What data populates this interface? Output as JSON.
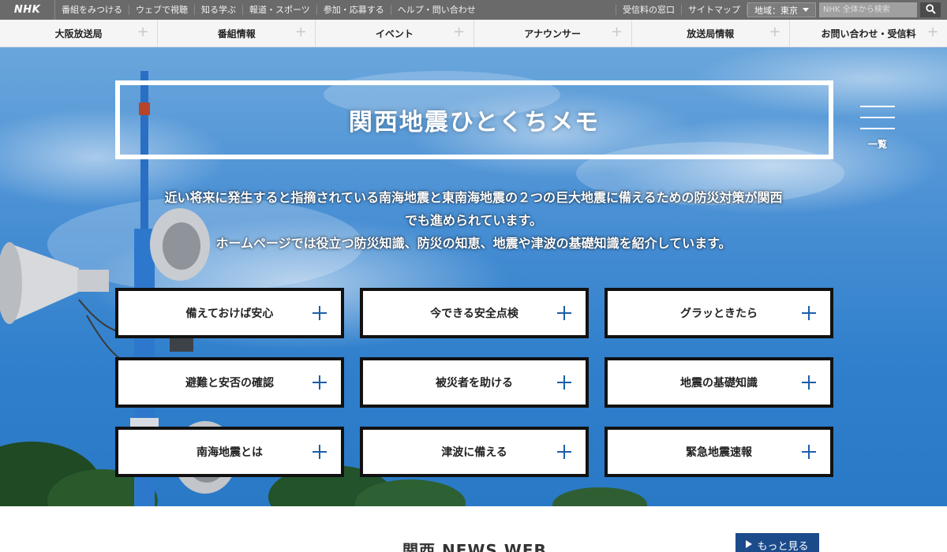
{
  "topbar": {
    "logo": "NHK",
    "links": [
      "番組をみつける",
      "ウェブで視聴",
      "知る学ぶ",
      "報道・スポーツ",
      "参加・応募する",
      "ヘルプ・問い合わせ"
    ],
    "right_links": [
      "受信料の窓口",
      "サイトマップ"
    ],
    "region_label": "地域：東京",
    "search_placeholder": "NHK 全体から検索"
  },
  "nav": {
    "items": [
      "大阪放送局",
      "番組情報",
      "イベント",
      "アナウンサー",
      "放送局情報",
      "お問い合わせ・受信料"
    ]
  },
  "hero": {
    "title": "関西地震ひとくちメモ",
    "menu_label": "一覧",
    "intro_lines": [
      "近い将来に発生すると指摘されている南海地震と東南海地震の２つの巨大地震に備えるための防災対策が関西",
      "でも進められています。",
      "ホームページでは役立つ防災知識、防災の知恵、地震や津波の基礎知識を紹介しています。"
    ]
  },
  "tiles": [
    "備えておけば安心",
    "今できる安全点検",
    "グラッときたら",
    "避難と安否の確認",
    "被災者を助ける",
    "地震の基礎知識",
    "南海地震とは",
    "津波に備える",
    "緊急地震速報"
  ],
  "news": {
    "title": "関西 NEWS WEB",
    "more_label": "もっと見る"
  },
  "colors": {
    "topbar": "#6a6a6a",
    "accent_plus": "#1c5ea8",
    "more_button": "#1c4b8c"
  }
}
